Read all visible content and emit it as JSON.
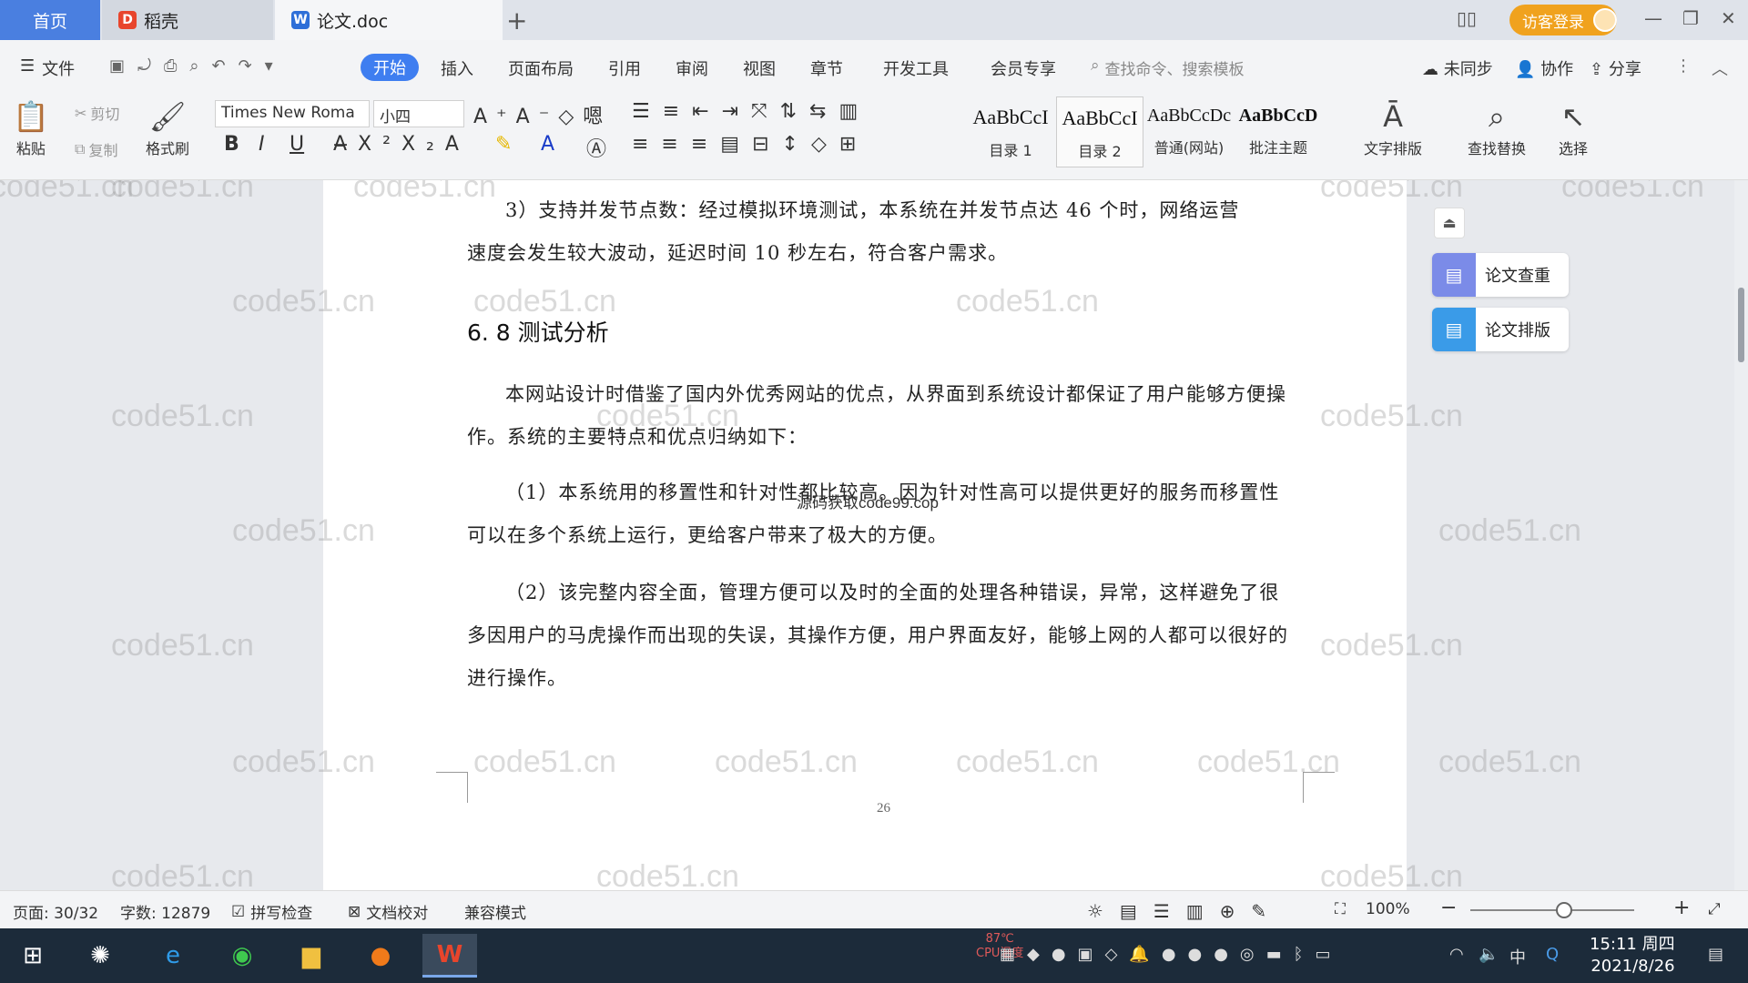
{
  "titlebar": {
    "tab_home": "首页",
    "tab_daoke": "稻壳",
    "tab_doc": "论文.doc",
    "add_tab": "+",
    "login_button": "访客登录"
  },
  "menubar": {
    "file": "文件",
    "start": "开始",
    "insert": "插入",
    "layout": "页面布局",
    "reference": "引用",
    "review": "审阅",
    "view": "视图",
    "chapter": "章节",
    "dev_tools": "开发工具",
    "member": "会员专享",
    "search_placeholder": "查找命令、搜索模板",
    "sync": "未同步",
    "collab": "协作",
    "share": "分享"
  },
  "ribbon": {
    "paste": "粘贴",
    "cut": "剪切",
    "copy": "复制",
    "format_painter": "格式刷",
    "font_name": "Times New Roma",
    "font_size": "小四",
    "styles": [
      {
        "sample": "AaBbCcI",
        "name": "目录 1"
      },
      {
        "sample": "AaBbCcI",
        "name": "目录 2"
      },
      {
        "sample": "AaBbCcDc",
        "name": "普通(网站)"
      },
      {
        "sample": "AaBbCcD",
        "name": "批注主题"
      }
    ],
    "text_layout": "文字排版",
    "find_replace": "查找替换",
    "select": "选择"
  },
  "document": {
    "para1_line1": "3）支持并发节点数：经过模拟环境测试，本系统在并发节点达 46 个时，网络运营",
    "para1_line2": "速度会发生较大波动，延迟时间 10 秒左右，符合客户需求。",
    "heading": "6. 8 测试分析",
    "para2": "本网站设计时借鉴了国内外优秀网站的优点，从界面到系统设计都保证了用户能够方便操作。系统的主要特点和优点归纳如下：",
    "para3": "（1）本系统用的移置性和针对性都比较高。因为针对性高可以提供更好的服务而移置性可以在多个系统上运行，更给客户带来了极大的方便。",
    "para4": "（2）该完整内容全面，管理方便可以及时的全面的处理各种错误，异常，这样避免了很多因用户的马虎操作而出现的失误，其操作方便，用户界面友好，能够上网的人都可以很好的进行操作。",
    "overlay_text": "源码获取code99.cop",
    "page_number": "26",
    "watermark": "code51.cn"
  },
  "sidepanel": {
    "check": "论文查重",
    "layout": "论文排版"
  },
  "statusbar": {
    "page": "页面: 30/32",
    "words": "字数: 12879",
    "spell": "拼写检查",
    "proof": "文档校对",
    "compat": "兼容模式",
    "zoom": "100%"
  },
  "taskbar": {
    "time": "15:11 周四",
    "date": "2021/8/26",
    "cpu_temp": "87℃",
    "cpu_label": "CPU温度",
    "ime": "中"
  }
}
